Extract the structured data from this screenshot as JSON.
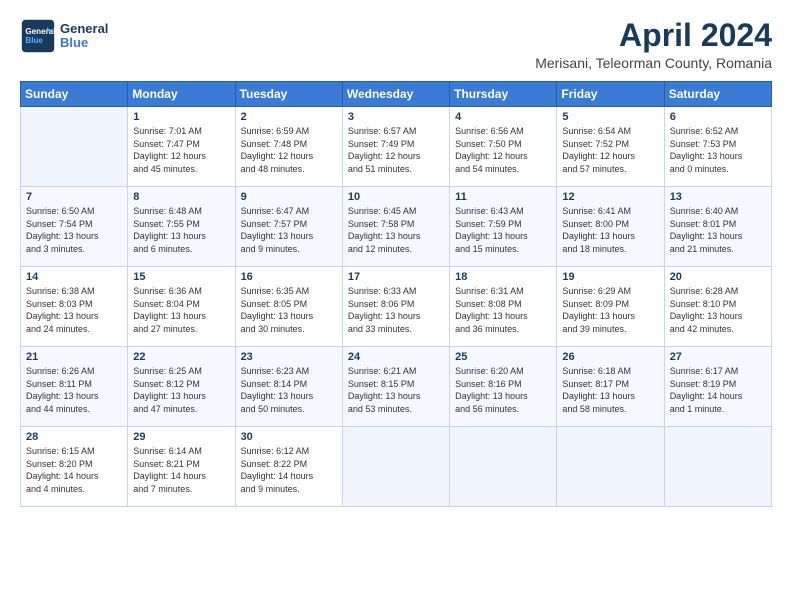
{
  "logo": {
    "line1": "General",
    "line2": "Blue"
  },
  "title": "April 2024",
  "subtitle": "Merisani, Teleorman County, Romania",
  "weekdays": [
    "Sunday",
    "Monday",
    "Tuesday",
    "Wednesday",
    "Thursday",
    "Friday",
    "Saturday"
  ],
  "weeks": [
    [
      {
        "day": "",
        "info": ""
      },
      {
        "day": "1",
        "info": "Sunrise: 7:01 AM\nSunset: 7:47 PM\nDaylight: 12 hours\nand 45 minutes."
      },
      {
        "day": "2",
        "info": "Sunrise: 6:59 AM\nSunset: 7:48 PM\nDaylight: 12 hours\nand 48 minutes."
      },
      {
        "day": "3",
        "info": "Sunrise: 6:57 AM\nSunset: 7:49 PM\nDaylight: 12 hours\nand 51 minutes."
      },
      {
        "day": "4",
        "info": "Sunrise: 6:56 AM\nSunset: 7:50 PM\nDaylight: 12 hours\nand 54 minutes."
      },
      {
        "day": "5",
        "info": "Sunrise: 6:54 AM\nSunset: 7:52 PM\nDaylight: 12 hours\nand 57 minutes."
      },
      {
        "day": "6",
        "info": "Sunrise: 6:52 AM\nSunset: 7:53 PM\nDaylight: 13 hours\nand 0 minutes."
      }
    ],
    [
      {
        "day": "7",
        "info": "Sunrise: 6:50 AM\nSunset: 7:54 PM\nDaylight: 13 hours\nand 3 minutes."
      },
      {
        "day": "8",
        "info": "Sunrise: 6:48 AM\nSunset: 7:55 PM\nDaylight: 13 hours\nand 6 minutes."
      },
      {
        "day": "9",
        "info": "Sunrise: 6:47 AM\nSunset: 7:57 PM\nDaylight: 13 hours\nand 9 minutes."
      },
      {
        "day": "10",
        "info": "Sunrise: 6:45 AM\nSunset: 7:58 PM\nDaylight: 13 hours\nand 12 minutes."
      },
      {
        "day": "11",
        "info": "Sunrise: 6:43 AM\nSunset: 7:59 PM\nDaylight: 13 hours\nand 15 minutes."
      },
      {
        "day": "12",
        "info": "Sunrise: 6:41 AM\nSunset: 8:00 PM\nDaylight: 13 hours\nand 18 minutes."
      },
      {
        "day": "13",
        "info": "Sunrise: 6:40 AM\nSunset: 8:01 PM\nDaylight: 13 hours\nand 21 minutes."
      }
    ],
    [
      {
        "day": "14",
        "info": "Sunrise: 6:38 AM\nSunset: 8:03 PM\nDaylight: 13 hours\nand 24 minutes."
      },
      {
        "day": "15",
        "info": "Sunrise: 6:36 AM\nSunset: 8:04 PM\nDaylight: 13 hours\nand 27 minutes."
      },
      {
        "day": "16",
        "info": "Sunrise: 6:35 AM\nSunset: 8:05 PM\nDaylight: 13 hours\nand 30 minutes."
      },
      {
        "day": "17",
        "info": "Sunrise: 6:33 AM\nSunset: 8:06 PM\nDaylight: 13 hours\nand 33 minutes."
      },
      {
        "day": "18",
        "info": "Sunrise: 6:31 AM\nSunset: 8:08 PM\nDaylight: 13 hours\nand 36 minutes."
      },
      {
        "day": "19",
        "info": "Sunrise: 6:29 AM\nSunset: 8:09 PM\nDaylight: 13 hours\nand 39 minutes."
      },
      {
        "day": "20",
        "info": "Sunrise: 6:28 AM\nSunset: 8:10 PM\nDaylight: 13 hours\nand 42 minutes."
      }
    ],
    [
      {
        "day": "21",
        "info": "Sunrise: 6:26 AM\nSunset: 8:11 PM\nDaylight: 13 hours\nand 44 minutes."
      },
      {
        "day": "22",
        "info": "Sunrise: 6:25 AM\nSunset: 8:12 PM\nDaylight: 13 hours\nand 47 minutes."
      },
      {
        "day": "23",
        "info": "Sunrise: 6:23 AM\nSunset: 8:14 PM\nDaylight: 13 hours\nand 50 minutes."
      },
      {
        "day": "24",
        "info": "Sunrise: 6:21 AM\nSunset: 8:15 PM\nDaylight: 13 hours\nand 53 minutes."
      },
      {
        "day": "25",
        "info": "Sunrise: 6:20 AM\nSunset: 8:16 PM\nDaylight: 13 hours\nand 56 minutes."
      },
      {
        "day": "26",
        "info": "Sunrise: 6:18 AM\nSunset: 8:17 PM\nDaylight: 13 hours\nand 58 minutes."
      },
      {
        "day": "27",
        "info": "Sunrise: 6:17 AM\nSunset: 8:19 PM\nDaylight: 14 hours\nand 1 minute."
      }
    ],
    [
      {
        "day": "28",
        "info": "Sunrise: 6:15 AM\nSunset: 8:20 PM\nDaylight: 14 hours\nand 4 minutes."
      },
      {
        "day": "29",
        "info": "Sunrise: 6:14 AM\nSunset: 8:21 PM\nDaylight: 14 hours\nand 7 minutes."
      },
      {
        "day": "30",
        "info": "Sunrise: 6:12 AM\nSunset: 8:22 PM\nDaylight: 14 hours\nand 9 minutes."
      },
      {
        "day": "",
        "info": ""
      },
      {
        "day": "",
        "info": ""
      },
      {
        "day": "",
        "info": ""
      },
      {
        "day": "",
        "info": ""
      }
    ]
  ]
}
